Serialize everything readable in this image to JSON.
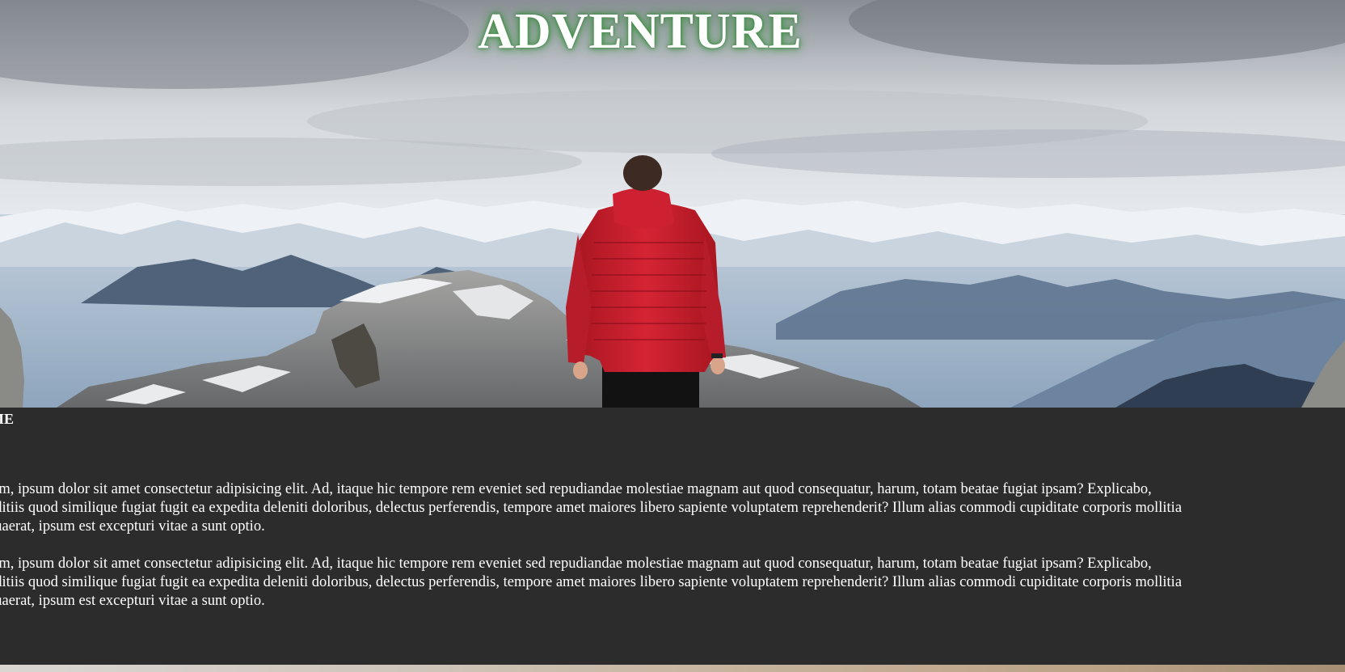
{
  "hero": {
    "title": "ADVENTURE"
  },
  "section": {
    "heading": "ME",
    "paragraphs": [
      {
        "lines": [
          "rem, ipsum dolor sit amet consectetur adipisicing elit. Ad, itaque hic tempore rem eveniet sed repudiandae molestiae magnam aut quod consequatur, harum, totam beatae fugiat ipsam? Explicabo,",
          "nditiis quod similique fugiat fugit ea expedita deleniti doloribus, delectus perferendis, tempore amet maiores libero sapiente voluptatem reprehenderit? Illum alias commodi cupiditate corporis mollitia",
          "quaerat, ipsum est excepturi vitae a sunt optio."
        ]
      },
      {
        "lines": [
          "rem, ipsum dolor sit amet consectetur adipisicing elit. Ad, itaque hic tempore rem eveniet sed repudiandae molestiae magnam aut quod consequatur, harum, totam beatae fugiat ipsam? Explicabo,",
          "nditiis quod similique fugiat fugit ea expedita deleniti doloribus, delectus perferendis, tempore amet maiores libero sapiente voluptatem reprehenderit? Illum alias commodi cupiditate corporis mollitia",
          "quaerat, ipsum est excepturi vitae a sunt optio."
        ]
      }
    ]
  },
  "colors": {
    "section_background": "#2c2c2c",
    "title_glow": "#4c9a52",
    "jacket": "#c8202f"
  }
}
